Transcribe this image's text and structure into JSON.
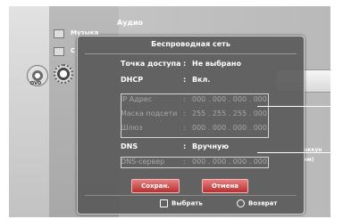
{
  "background": {
    "audio_title": "Аудио",
    "menu_items": [
      "Музыка",
      "С"
    ],
    "right_labels": [
      "а",
      "/аккун",
      "ям)"
    ],
    "dvd_label": "DVD"
  },
  "dialog": {
    "title": "Беспроводная сеть",
    "rows": [
      {
        "label": "Точка доступа",
        "value": "Не выбрано"
      },
      {
        "label": "DHCP",
        "value": "Вкл."
      },
      {
        "label": "IP Адрес",
        "value": "000 . 000 . 000 . 000"
      },
      {
        "label": "Маска подсети",
        "value": "255 . 255 . 255 . 000"
      },
      {
        "label": "Шлюз",
        "value": "000 . 000 . 000 . 000"
      },
      {
        "label": "DNS",
        "value": "Вручную"
      },
      {
        "label": "DNS-сервер",
        "value": "000 . 000 . 000 . 000"
      }
    ],
    "buttons": {
      "save": "Сохран.",
      "cancel": "Отмена"
    },
    "footer": {
      "select": "Выбрать",
      "back": "Возврат"
    }
  }
}
